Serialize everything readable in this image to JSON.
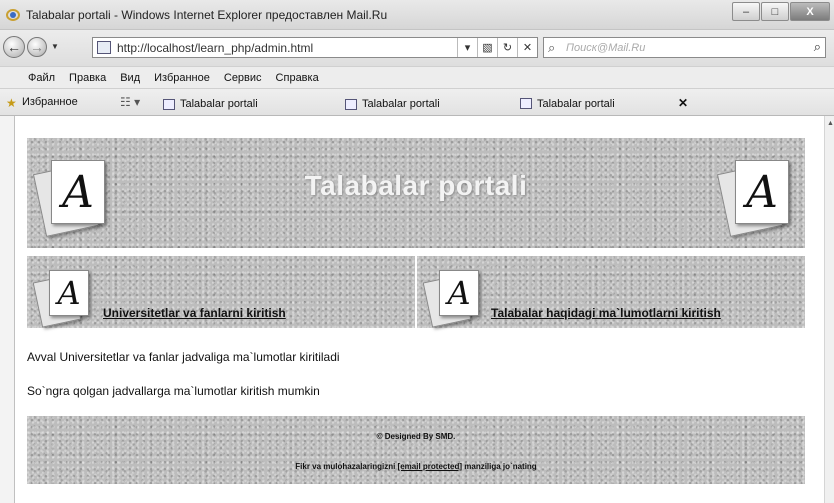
{
  "window": {
    "title": "Talabalar portali - Windows Internet Explorer предоставлен Mail.Ru",
    "minimize": "–",
    "maximize": "□",
    "close": "X"
  },
  "address_bar": {
    "url": "http://localhost/learn_php/admin.html",
    "search_placeholder": "Поиск@Mail.Ru"
  },
  "menu": [
    "Файл",
    "Правка",
    "Вид",
    "Избранное",
    "Сервис",
    "Справка"
  ],
  "favorites": {
    "label": "Избранное",
    "tabs": [
      "Talabalar portali",
      "Talabalar portali",
      "Talabalar portali"
    ]
  },
  "page": {
    "banner_title": "Talabalar portali",
    "logo_letter": "A",
    "nav_links": [
      "Universitetlar va fanlarni kiritish",
      "Talabalar haqidagi ma`lumotlarni kiritish"
    ],
    "paragraphs": [
      "Avval Universitetlar va fanlar jadvaliga ma`lumotlar kiritiladi",
      "So`ngra qolgan jadvallarga ma`lumotlar kiritish mumkin"
    ],
    "footer": {
      "designed_by": "© Designed By SMD.",
      "feedback_prefix": "Fikr va mulohazalaringizni",
      "feedback_email": "[email protected]",
      "feedback_suffix": "manziliga jo`nating"
    }
  }
}
